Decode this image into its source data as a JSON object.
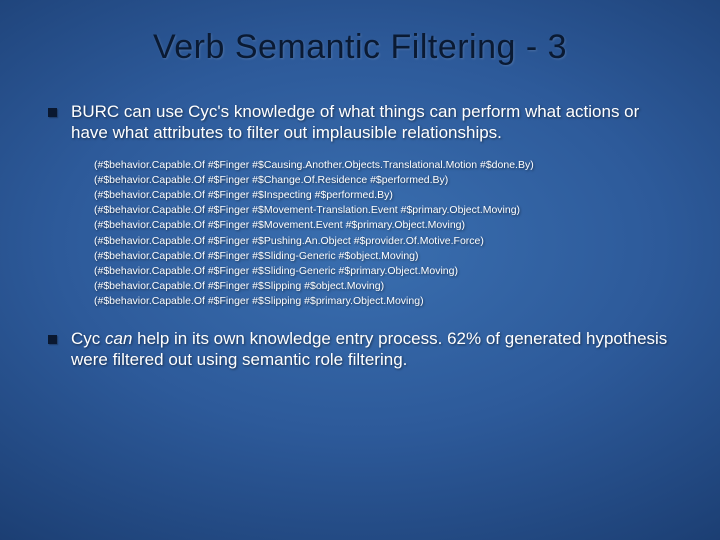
{
  "slide": {
    "title": "Verb Semantic Filtering - 3",
    "bullets": [
      {
        "text": "BURC can use Cyc's knowledge of what things can perform what actions or have what attributes to filter out implausible relationships."
      },
      {
        "prefix": "Cyc ",
        "italic": "can",
        "suffix": " help in its own knowledge entry process. 62% of generated hypothesis were filtered out using semantic role filtering."
      }
    ],
    "code_lines": [
      "(#$behavior.Capable.Of #$Finger #$Causing.Another.Objects.Translational.Motion #$done.By)",
      "(#$behavior.Capable.Of #$Finger #$Change.Of.Residence #$performed.By)",
      "(#$behavior.Capable.Of #$Finger #$Inspecting #$performed.By)",
      "(#$behavior.Capable.Of #$Finger #$Movement-Translation.Event #$primary.Object.Moving)",
      "(#$behavior.Capable.Of #$Finger #$Movement.Event #$primary.Object.Moving)",
      "(#$behavior.Capable.Of #$Finger #$Pushing.An.Object #$provider.Of.Motive.Force)",
      "(#$behavior.Capable.Of #$Finger #$Sliding-Generic #$object.Moving)",
      "(#$behavior.Capable.Of #$Finger #$Sliding-Generic #$primary.Object.Moving)",
      "(#$behavior.Capable.Of #$Finger #$Slipping #$object.Moving)",
      "(#$behavior.Capable.Of #$Finger #$Slipping #$primary.Object.Moving)"
    ]
  }
}
